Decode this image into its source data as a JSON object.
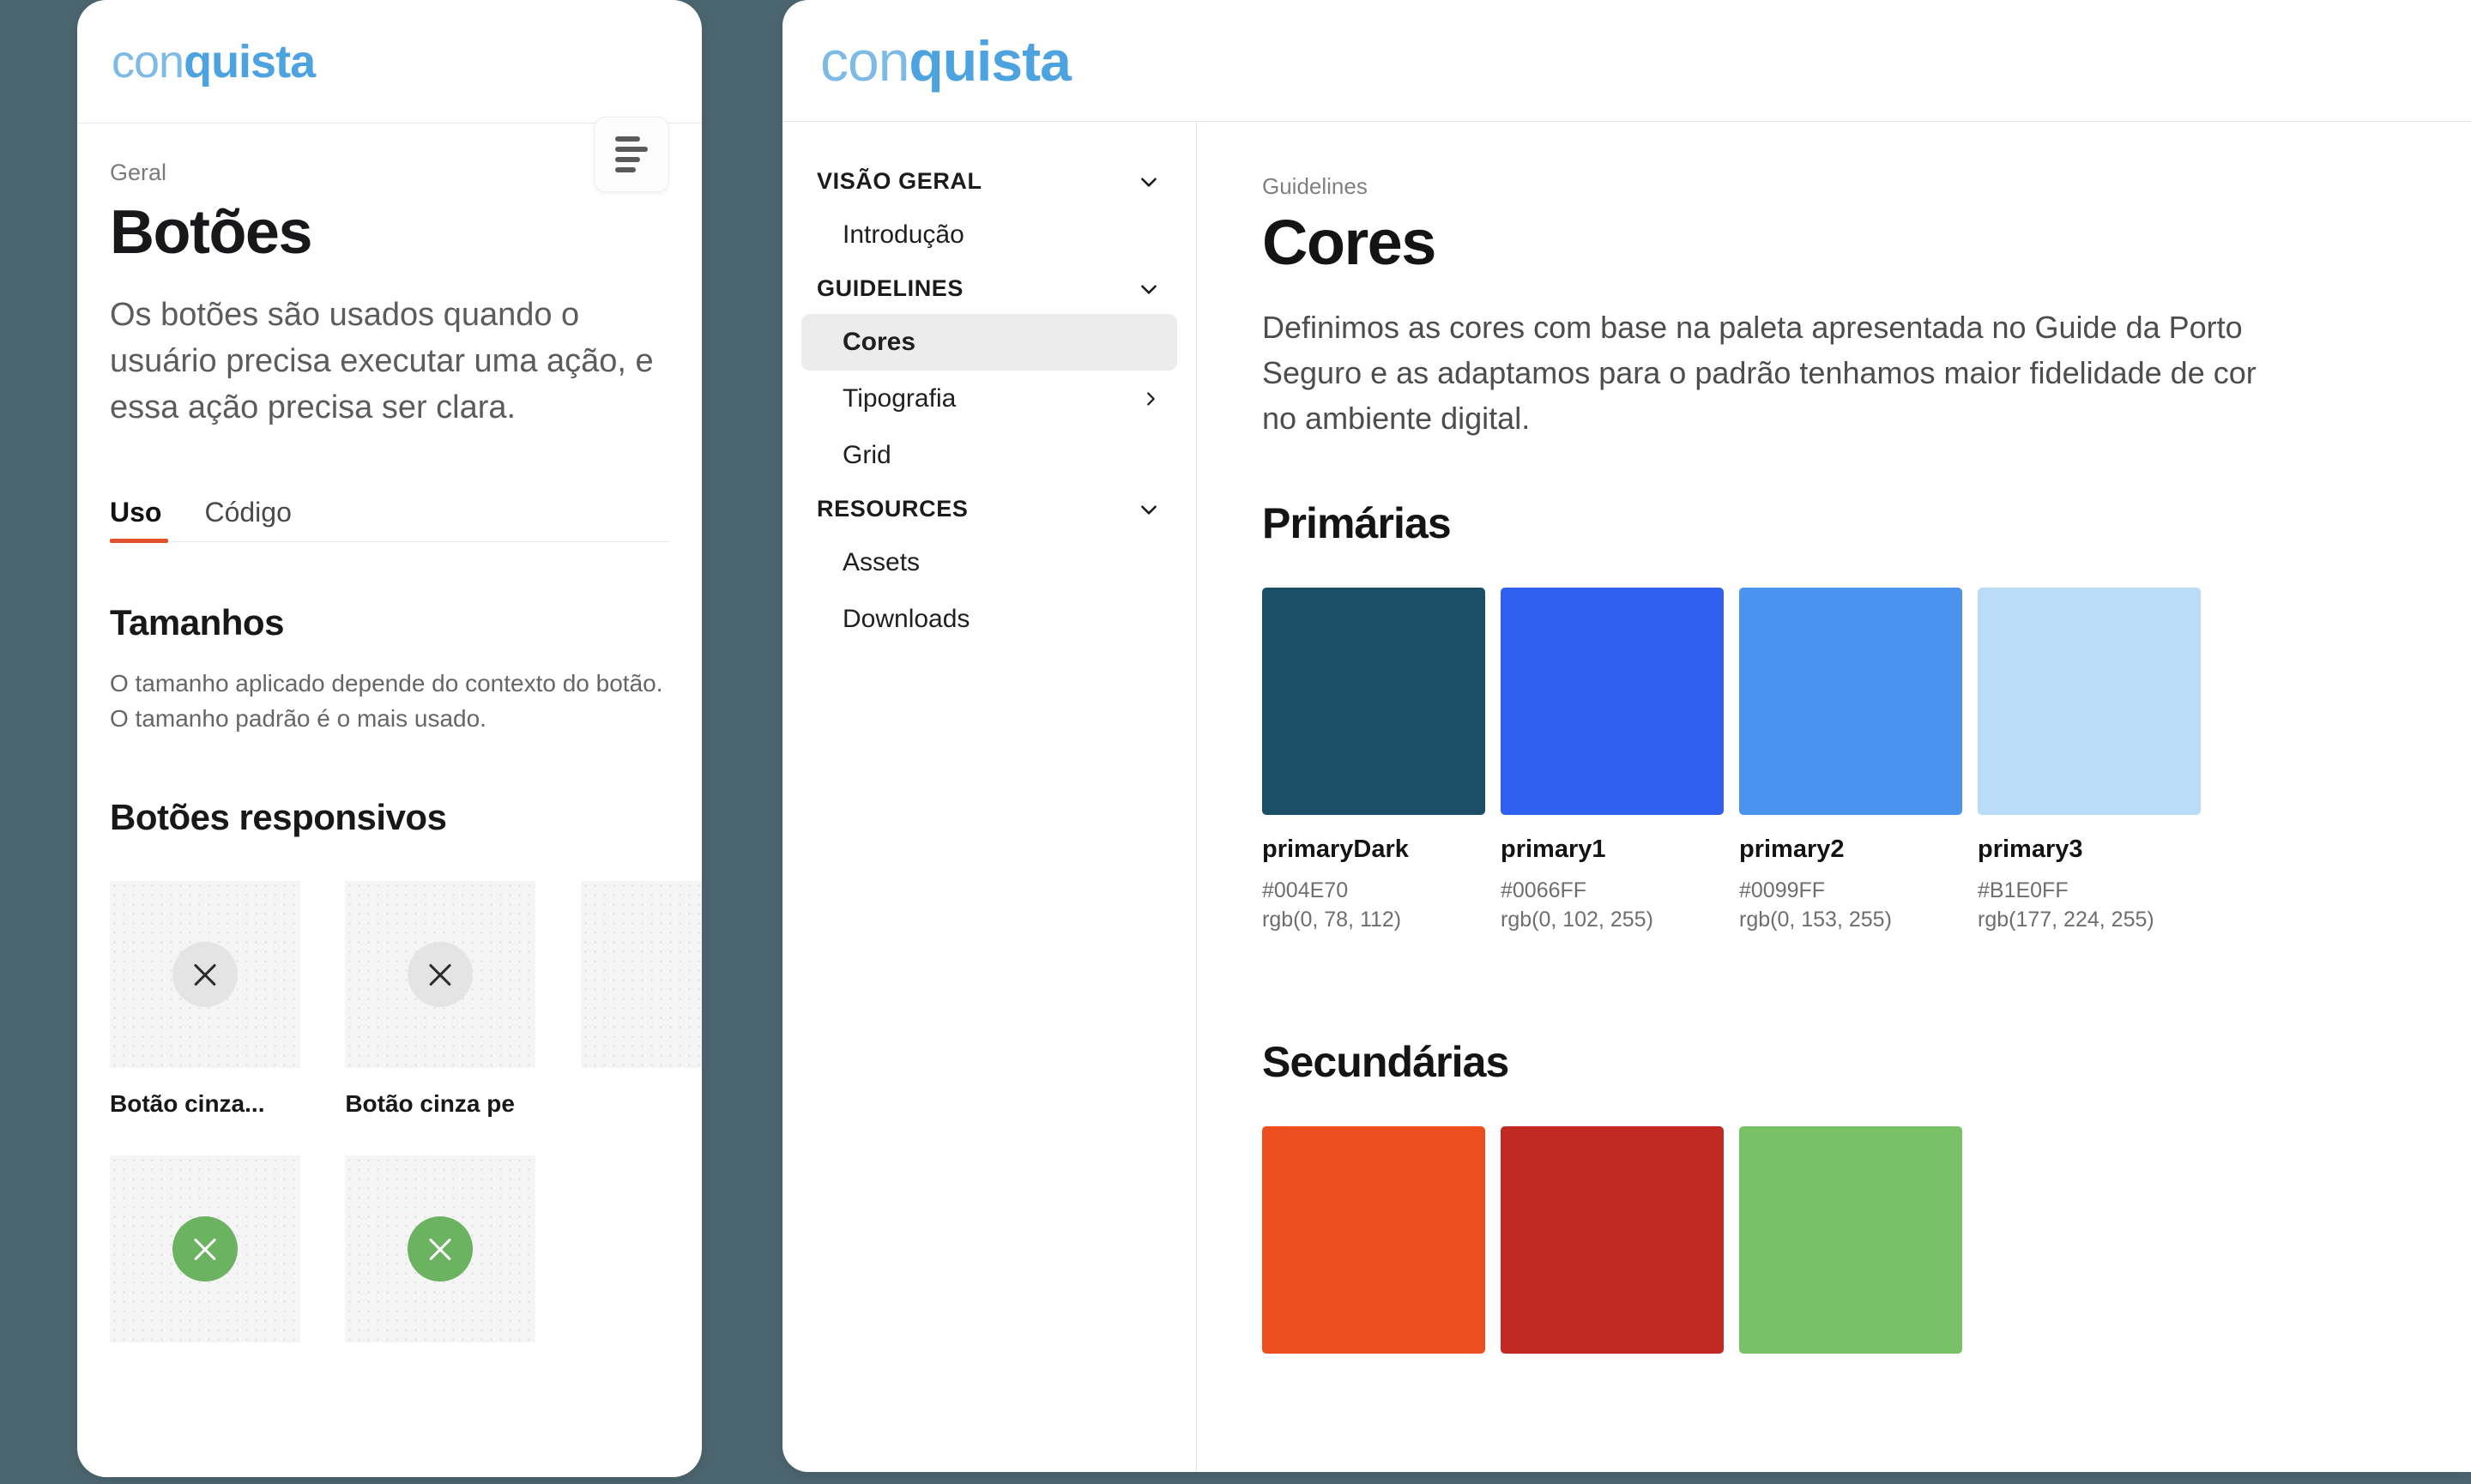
{
  "theme": {
    "page_background": "#4c6670",
    "logo_light_color": "#7dbbe6",
    "logo_bold_color": "#4da3e0",
    "tab_accent_color": "#e0522a",
    "nav_active_background": "#ececec"
  },
  "brand": {
    "logo_prefix": "con",
    "logo_suffix": "quista"
  },
  "mobile": {
    "eyebrow": "Geral",
    "title": "Botões",
    "lead": "Os botões são usados quando o usuário precisa executar uma ação, e essa ação precisa ser clara.",
    "menu_button_label": "",
    "tabs": [
      {
        "label": "Uso",
        "active": true
      },
      {
        "label": "Código",
        "active": false
      }
    ],
    "section": {
      "title": "Tamanhos",
      "text": "O tamanho aplicado depende do contexto do botão. O tamanho padrão é o mais usado."
    },
    "responsive": {
      "title": "Botões responsivos",
      "cards": [
        {
          "label": "Botão cinza...",
          "pill": "grey",
          "icon": "close-icon"
        },
        {
          "label": "Botão cinza pe",
          "pill": "grey",
          "icon": "close-icon"
        },
        {
          "label": "",
          "pill": "green",
          "icon": "close-icon"
        },
        {
          "label": "",
          "pill": "green",
          "icon": "close-icon"
        }
      ]
    }
  },
  "desktop": {
    "sidebar": {
      "groups": [
        {
          "label": "VISÃO GERAL",
          "icon": "chevron-down-icon",
          "items": [
            {
              "label": "Introdução",
              "active": false,
              "icon": null
            }
          ]
        },
        {
          "label": "GUIDELINES",
          "icon": "chevron-down-icon",
          "items": [
            {
              "label": "Cores",
              "active": true,
              "icon": null
            },
            {
              "label": "Tipografia",
              "active": false,
              "icon": "chevron-right-icon"
            },
            {
              "label": "Grid",
              "active": false,
              "icon": null
            }
          ]
        },
        {
          "label": "RESOURCES",
          "icon": "chevron-down-icon",
          "items": [
            {
              "label": "Assets",
              "active": false,
              "icon": null
            },
            {
              "label": "Downloads",
              "active": false,
              "icon": null
            }
          ]
        }
      ]
    },
    "content": {
      "eyebrow": "Guidelines",
      "title": "Cores",
      "lead": "Definimos as cores com base na paleta apresentada no Guide da Porto Seguro e as adaptamos para o padrão tenhamos maior fidelidade de cor no ambiente digital.",
      "primary_heading": "Primárias",
      "primary_swatches": [
        {
          "name": "primaryDark",
          "hex": "#004E70",
          "rgb": "rgb(0, 78, 112)",
          "render": "#1d4e68"
        },
        {
          "name": "primary1",
          "hex": "#0066FF",
          "rgb": "rgb(0, 102, 255)",
          "render": "#2f60f0"
        },
        {
          "name": "primary2",
          "hex": "#0099FF",
          "rgb": "rgb(0, 153, 255)",
          "render": "#4a94ef"
        },
        {
          "name": "primary3",
          "hex": "#B1E0FF",
          "rgb": "rgb(177, 224, 255)",
          "render": "#bbdcf7"
        }
      ],
      "secondary_heading": "Secundárias",
      "secondary_swatches": [
        {
          "name": "",
          "hex": "",
          "rgb": "",
          "render": "#ec4e1e"
        },
        {
          "name": "",
          "hex": "",
          "rgb": "",
          "render": "#c02a23"
        },
        {
          "name": "",
          "hex": "",
          "rgb": "",
          "render": "#79c167"
        }
      ]
    }
  }
}
